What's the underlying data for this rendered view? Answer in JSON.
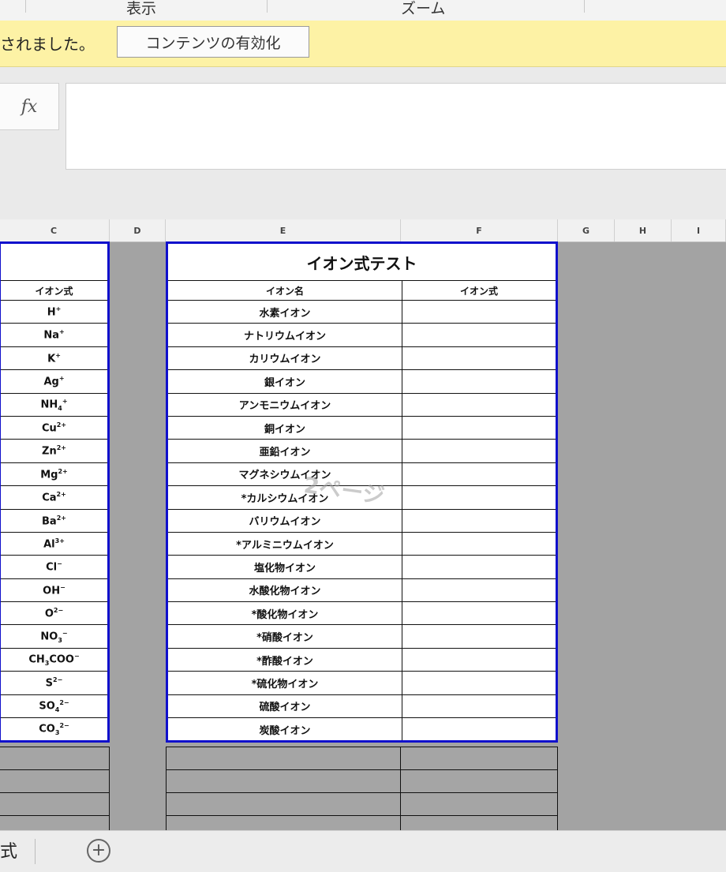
{
  "ribbon": {
    "groups": [
      "表示",
      "ズーム"
    ]
  },
  "message_bar": {
    "text": "されました。",
    "enable_button": "コンテンツの有効化"
  },
  "formula_bar": {
    "fx_label": "fx",
    "value": ""
  },
  "columns": [
    "C",
    "D",
    "E",
    "F",
    "G",
    "H",
    "I"
  ],
  "left_table": {
    "header": "イオン式",
    "formulas": [
      {
        "base": "H",
        "sup": "+"
      },
      {
        "base": "Na",
        "sup": "+"
      },
      {
        "base": "K",
        "sup": "+"
      },
      {
        "base": "Ag",
        "sup": "+"
      },
      {
        "base": "NH",
        "sub": "4",
        "sup": "+"
      },
      {
        "base": "Cu",
        "sup": "2+"
      },
      {
        "base": "Zn",
        "sup": "2+"
      },
      {
        "base": "Mg",
        "sup": "2+"
      },
      {
        "base": "Ca",
        "sup": "2+"
      },
      {
        "base": "Ba",
        "sup": "2+"
      },
      {
        "base": "Al",
        "sup": "3+"
      },
      {
        "base": "Cl",
        "sup": "−"
      },
      {
        "base": "OH",
        "sup": "−"
      },
      {
        "base": "O",
        "sup": "2−"
      },
      {
        "base": "NO",
        "sub": "3",
        "sup": "−"
      },
      {
        "base": "CH",
        "sub": "3",
        "post": "COO",
        "sup": "−"
      },
      {
        "base": "S",
        "sup": "2−"
      },
      {
        "base": "SO",
        "sub": "4",
        "sup": "2−"
      },
      {
        "base": "CO",
        "sub": "3",
        "sup": "2−"
      }
    ]
  },
  "right_table": {
    "title": "イオン式テスト",
    "col_name_header": "イオン名",
    "col_formula_header": "イオン式",
    "names": [
      "水素イオン",
      "ナトリウムイオン",
      "カリウムイオン",
      "銀イオン",
      "アンモニウムイオン",
      "銅イオン",
      "亜鉛イオン",
      "マグネシウムイオン",
      "*カルシウムイオン",
      "バリウムイオン",
      "*アルミニウムイオン",
      "塩化物イオン",
      "水酸化物イオン",
      "*酸化物イオン",
      "*硝酸イオン",
      "*酢酸イオン",
      "*硫化物イオン",
      "硫酸イオン",
      "炭酸イオン"
    ]
  },
  "watermark": "2ページ",
  "sheet_tabs": {
    "active_tab_fragment": "式",
    "add_icon": "plus-circle-icon"
  }
}
